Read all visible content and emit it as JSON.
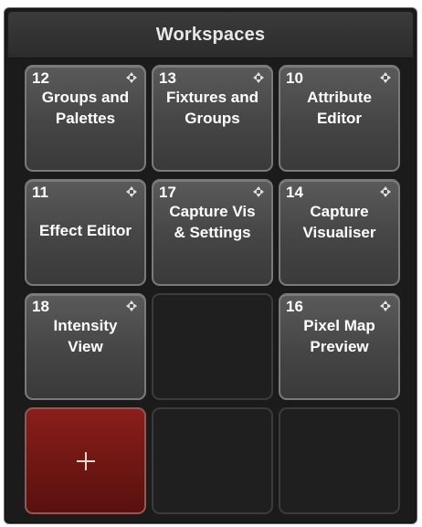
{
  "panel": {
    "title": "Workspaces"
  },
  "tiles": [
    {
      "number": "12",
      "label": "Groups and\nPalettes",
      "icon": "move-icon"
    },
    {
      "number": "13",
      "label": "Fixtures and\nGroups",
      "icon": "move-icon"
    },
    {
      "number": "10",
      "label": "Attribute\nEditor",
      "icon": "move-icon"
    },
    {
      "number": "11",
      "label": "Effect Editor",
      "icon": "move-icon"
    },
    {
      "number": "17",
      "label": "Capture Vis\n& Settings",
      "icon": "move-icon"
    },
    {
      "number": "14",
      "label": "Capture\nVisualiser",
      "icon": "move-icon"
    },
    {
      "number": "18",
      "label": "Intensity\nView",
      "icon": "move-icon"
    },
    {
      "number": "16",
      "label": "Pixel Map\nPreview",
      "icon": "move-icon"
    }
  ],
  "add_button": {
    "icon": "plus-icon",
    "color": "#7a1a16"
  }
}
